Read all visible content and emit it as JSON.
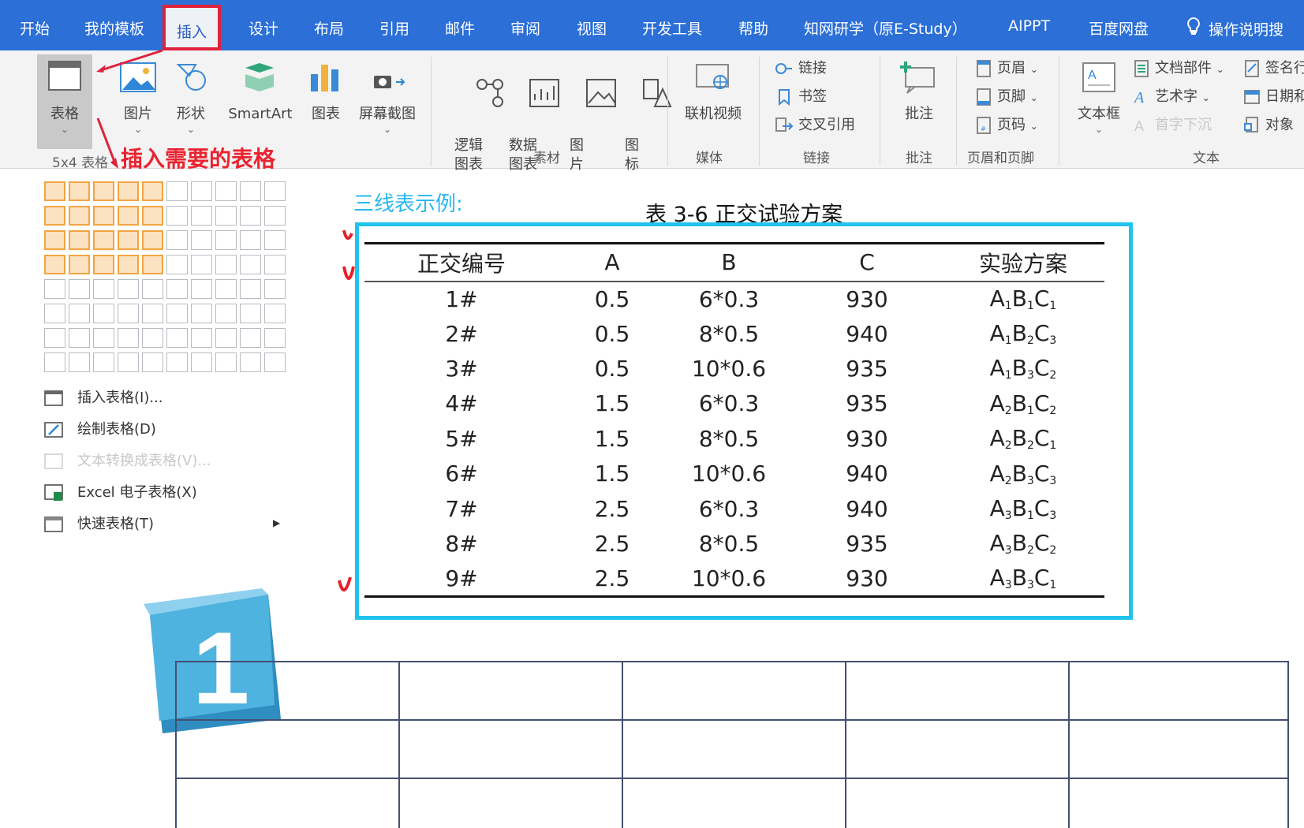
{
  "tabs": [
    {
      "label": "开始",
      "active": false
    },
    {
      "label": "我的模板",
      "active": false
    },
    {
      "label": "插入",
      "active": true
    },
    {
      "label": "设计",
      "active": false
    },
    {
      "label": "布局",
      "active": false
    },
    {
      "label": "引用",
      "active": false
    },
    {
      "label": "邮件",
      "active": false
    },
    {
      "label": "审阅",
      "active": false
    },
    {
      "label": "视图",
      "active": false
    },
    {
      "label": "开发工具",
      "active": false
    },
    {
      "label": "帮助",
      "active": false
    },
    {
      "label": "知网研学（原E-Study）",
      "active": false
    },
    {
      "label": "AIPPT",
      "active": false
    },
    {
      "label": "百度网盘",
      "active": false
    },
    {
      "label": "操作说明搜",
      "active": false,
      "icon": "lightbulb-icon"
    }
  ],
  "ribbon": {
    "table_btn": "表格",
    "picture_btn": "图片",
    "shape_btn": "形状",
    "smartart_btn": "SmartArt",
    "chart_btn": "图表",
    "screenshot_btn": "屏幕截图",
    "logic_chart_btn": "逻辑\n图表",
    "data_chart_btn": "数据\n图表",
    "image_btn": "图\n片",
    "icon_btn": "图\n标",
    "online_video_btn": "联机视频",
    "link_btn": "链接",
    "bookmark_btn": "书签",
    "cross_ref_btn": "交叉引用",
    "comment_btn": "批注",
    "header_btn": "页眉",
    "footer_btn": "页脚",
    "page_num_btn": "页码",
    "textbox_btn": "文本框",
    "doc_parts_btn": "文档部件",
    "wordart_btn": "艺术字",
    "dropcap_btn": "首字下沉",
    "signature_btn": "签名行",
    "datetime_btn": "日期和",
    "object_btn": "对象",
    "groups": {
      "material": "素材",
      "media": "媒体",
      "links": "链接",
      "comments": "批注",
      "header_footer": "页眉和页脚",
      "text": "文本"
    }
  },
  "table_menu": {
    "grid_label": "5x4 表格",
    "grid_cols": 10,
    "grid_rows": 8,
    "selected_cols": 5,
    "selected_rows": 4,
    "items": [
      {
        "label": "插入表格(I)...",
        "icon": "insert-table-icon",
        "enabled": true
      },
      {
        "label": "绘制表格(D)",
        "icon": "draw-table-icon",
        "enabled": true
      },
      {
        "label": "文本转换成表格(V)...",
        "icon": "convert-text-icon",
        "enabled": false
      },
      {
        "label": "Excel 电子表格(X)",
        "icon": "excel-icon",
        "enabled": true
      },
      {
        "label": "快速表格(T)",
        "icon": "quick-table-icon",
        "enabled": true,
        "submenu": true
      }
    ]
  },
  "annotations": {
    "insert_hint": "插入需要的表格",
    "example_label": "三线表示例:"
  },
  "example_table": {
    "title": "表 3-6 正交试验方案",
    "headers": [
      "正交编号",
      "A",
      "B",
      "C",
      "实验方案"
    ],
    "rows": [
      [
        "1#",
        "0.5",
        "6*0.3",
        "930",
        [
          "1",
          "1",
          "1"
        ]
      ],
      [
        "2#",
        "0.5",
        "8*0.5",
        "940",
        [
          "1",
          "2",
          "3"
        ]
      ],
      [
        "3#",
        "0.5",
        "10*0.6",
        "935",
        [
          "1",
          "3",
          "2"
        ]
      ],
      [
        "4#",
        "1.5",
        "6*0.3",
        "935",
        [
          "2",
          "1",
          "2"
        ]
      ],
      [
        "5#",
        "1.5",
        "8*0.5",
        "930",
        [
          "2",
          "2",
          "1"
        ]
      ],
      [
        "6#",
        "1.5",
        "10*0.6",
        "940",
        [
          "2",
          "3",
          "3"
        ]
      ],
      [
        "7#",
        "2.5",
        "6*0.3",
        "940",
        [
          "3",
          "1",
          "3"
        ]
      ],
      [
        "8#",
        "2.5",
        "8*0.5",
        "935",
        [
          "3",
          "2",
          "2"
        ]
      ],
      [
        "9#",
        "2.5",
        "10*0.6",
        "930",
        [
          "3",
          "3",
          "1"
        ]
      ]
    ]
  },
  "step_badge": "1",
  "colors": {
    "ribbon_blue": "#2b6fd7",
    "highlight_red": "#e0223c",
    "frame_cyan": "#1fc3ee",
    "grid_selected": "#f3a443"
  }
}
